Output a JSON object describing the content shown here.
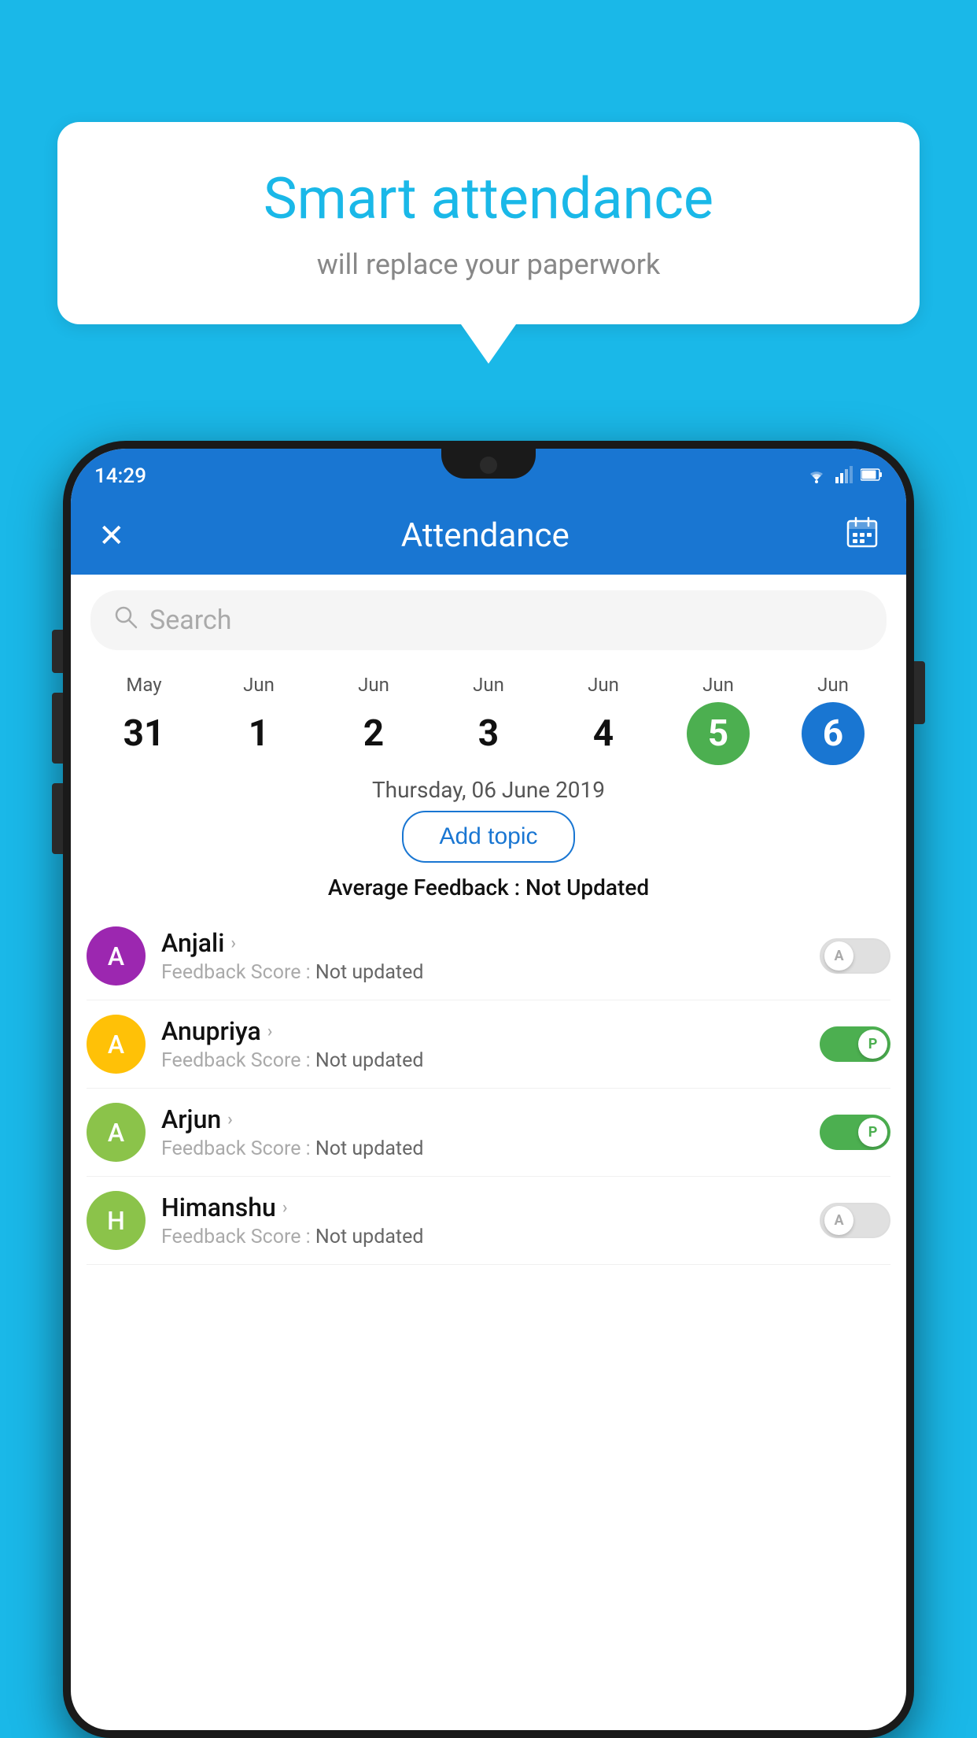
{
  "background_color": "#1ab8e8",
  "speech_bubble": {
    "title": "Smart attendance",
    "subtitle": "will replace your paperwork"
  },
  "status_bar": {
    "time": "14:29",
    "wifi": "▾",
    "signal": "▲",
    "battery": "▮"
  },
  "app_header": {
    "title": "Attendance",
    "close_label": "✕",
    "calendar_icon": "📅"
  },
  "search": {
    "placeholder": "Search"
  },
  "calendar": {
    "days": [
      {
        "month": "May",
        "date": "31",
        "state": "normal"
      },
      {
        "month": "Jun",
        "date": "1",
        "state": "normal"
      },
      {
        "month": "Jun",
        "date": "2",
        "state": "normal"
      },
      {
        "month": "Jun",
        "date": "3",
        "state": "normal"
      },
      {
        "month": "Jun",
        "date": "4",
        "state": "normal"
      },
      {
        "month": "Jun",
        "date": "5",
        "state": "today"
      },
      {
        "month": "Jun",
        "date": "6",
        "state": "selected"
      }
    ]
  },
  "selected_date_label": "Thursday, 06 June 2019",
  "add_topic_label": "Add topic",
  "avg_feedback_label": "Average Feedback :",
  "avg_feedback_value": "Not Updated",
  "students": [
    {
      "name": "Anjali",
      "avatar_letter": "A",
      "avatar_color": "#9c27b0",
      "feedback_label": "Feedback Score :",
      "feedback_value": "Not updated",
      "toggle_state": "off",
      "toggle_letter": "A"
    },
    {
      "name": "Anupriya",
      "avatar_letter": "A",
      "avatar_color": "#ffc107",
      "feedback_label": "Feedback Score :",
      "feedback_value": "Not updated",
      "toggle_state": "on",
      "toggle_letter": "P"
    },
    {
      "name": "Arjun",
      "avatar_letter": "A",
      "avatar_color": "#8bc34a",
      "feedback_label": "Feedback Score :",
      "feedback_value": "Not updated",
      "toggle_state": "on",
      "toggle_letter": "P"
    },
    {
      "name": "Himanshu",
      "avatar_letter": "H",
      "avatar_color": "#8bc34a",
      "feedback_label": "Feedback Score :",
      "feedback_value": "Not updated",
      "toggle_state": "off",
      "toggle_letter": "A"
    }
  ]
}
